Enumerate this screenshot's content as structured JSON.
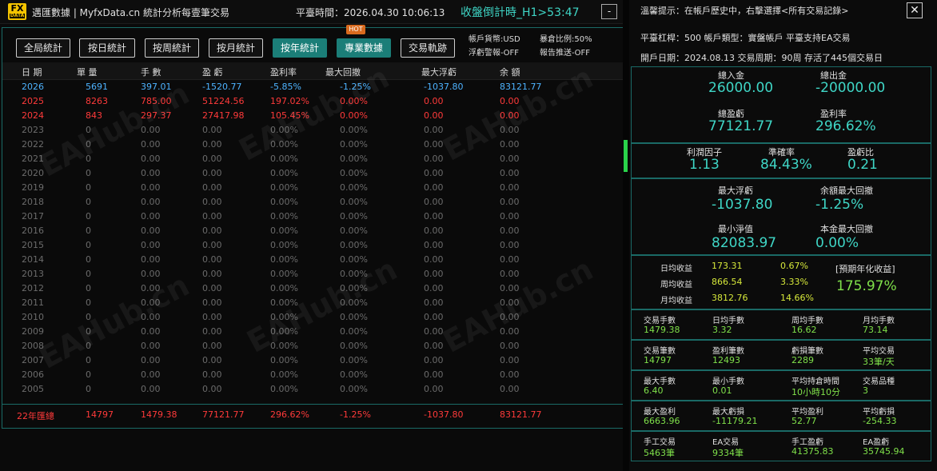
{
  "titlebar": {
    "logo_top": "FX",
    "logo_bottom": "DATA",
    "title": "邁匯數據 | MyfxData.cn  統計分析每壹筆交易",
    "server_time": "平臺時間：2026.04.30 10:06:13",
    "countdown": "收盤倒計時_H1>53:47",
    "minimize": "-"
  },
  "tabs": [
    "全局統計",
    "按日統計",
    "按周統計",
    "按月統計",
    "按年統計",
    "專業數據",
    "交易軌跡"
  ],
  "hot_badge": "HOT",
  "account_info": {
    "currency": "帳戶貨幣:USD",
    "float_alert": "浮虧警報-OFF",
    "margin_ratio": "暴倉比例:50%",
    "report_push": "報告推送-OFF"
  },
  "table": {
    "headers": [
      "日 期",
      "單 量",
      "手 數",
      "盈 虧",
      "盈利率",
      "最大回撤",
      "最大浮虧",
      "余 額"
    ],
    "rows": [
      [
        "2026",
        "5691",
        "397.01",
        "-1520.77",
        "-5.85%",
        "-1.25%",
        "-1037.80",
        "83121.77"
      ],
      [
        "2025",
        "8263",
        "785.00",
        "51224.56",
        "197.02%",
        "0.00%",
        "0.00",
        "0.00"
      ],
      [
        "2024",
        "843",
        "297.37",
        "27417.98",
        "105.45%",
        "0.00%",
        "0.00",
        "0.00"
      ],
      [
        "2023",
        "0",
        "0.00",
        "0.00",
        "0.00%",
        "0.00%",
        "0.00",
        "0.00"
      ],
      [
        "2022",
        "0",
        "0.00",
        "0.00",
        "0.00%",
        "0.00%",
        "0.00",
        "0.00"
      ],
      [
        "2021",
        "0",
        "0.00",
        "0.00",
        "0.00%",
        "0.00%",
        "0.00",
        "0.00"
      ],
      [
        "2020",
        "0",
        "0.00",
        "0.00",
        "0.00%",
        "0.00%",
        "0.00",
        "0.00"
      ],
      [
        "2019",
        "0",
        "0.00",
        "0.00",
        "0.00%",
        "0.00%",
        "0.00",
        "0.00"
      ],
      [
        "2018",
        "0",
        "0.00",
        "0.00",
        "0.00%",
        "0.00%",
        "0.00",
        "0.00"
      ],
      [
        "2017",
        "0",
        "0.00",
        "0.00",
        "0.00%",
        "0.00%",
        "0.00",
        "0.00"
      ],
      [
        "2016",
        "0",
        "0.00",
        "0.00",
        "0.00%",
        "0.00%",
        "0.00",
        "0.00"
      ],
      [
        "2015",
        "0",
        "0.00",
        "0.00",
        "0.00%",
        "0.00%",
        "0.00",
        "0.00"
      ],
      [
        "2014",
        "0",
        "0.00",
        "0.00",
        "0.00%",
        "0.00%",
        "0.00",
        "0.00"
      ],
      [
        "2013",
        "0",
        "0.00",
        "0.00",
        "0.00%",
        "0.00%",
        "0.00",
        "0.00"
      ],
      [
        "2012",
        "0",
        "0.00",
        "0.00",
        "0.00%",
        "0.00%",
        "0.00",
        "0.00"
      ],
      [
        "2011",
        "0",
        "0.00",
        "0.00",
        "0.00%",
        "0.00%",
        "0.00",
        "0.00"
      ],
      [
        "2010",
        "0",
        "0.00",
        "0.00",
        "0.00%",
        "0.00%",
        "0.00",
        "0.00"
      ],
      [
        "2009",
        "0",
        "0.00",
        "0.00",
        "0.00%",
        "0.00%",
        "0.00",
        "0.00"
      ],
      [
        "2008",
        "0",
        "0.00",
        "0.00",
        "0.00%",
        "0.00%",
        "0.00",
        "0.00"
      ],
      [
        "2007",
        "0",
        "0.00",
        "0.00",
        "0.00%",
        "0.00%",
        "0.00",
        "0.00"
      ],
      [
        "2006",
        "0",
        "0.00",
        "0.00",
        "0.00%",
        "0.00%",
        "0.00",
        "0.00"
      ],
      [
        "2005",
        "0",
        "0.00",
        "0.00",
        "0.00%",
        "0.00%",
        "0.00",
        "0.00"
      ]
    ],
    "summary": [
      "22年匯總",
      "14797",
      "1479.38",
      "77121.77",
      "296.62%",
      "-1.25%",
      "-1037.80",
      "83121.77"
    ]
  },
  "watermark": "EAHub.cn",
  "right": {
    "tip": "溫馨提示：在帳戶歷史中，右擊選擇<所有交易記錄>",
    "close": "✕",
    "line1": "平臺杠桿：500      帳戶類型：實盤帳戶      平臺支持EA交易",
    "line2": "開戶日期：2024.08.13    交易周期：90周    存活了445個交易日",
    "deposit_label": "總入金",
    "deposit": "26000.00",
    "withdraw_label": "總出金",
    "withdraw": "-20000.00",
    "profit_label": "總盈虧",
    "profit": "77121.77",
    "rate_label": "盈利率",
    "rate": "296.62%",
    "pf_label": "利潤因子",
    "pf": "1.13",
    "acc_label": "準確率",
    "acc": "84.43%",
    "pl_label": "盈虧比",
    "pl": "0.21",
    "maxfloat_label": "最大浮虧",
    "maxfloat": "-1037.80",
    "maxdd_label": "余額最大回撤",
    "maxdd": "-1.25%",
    "minnet_label": "最小淨值",
    "minnet": "82083.97",
    "principal_label": "本金最大回撤",
    "principal": "0.00%",
    "daily_label": "日均收益",
    "daily": "173.31",
    "daily_pct": "0.67%",
    "weekly_label": "周均收益",
    "weekly": "866.54",
    "weekly_pct": "3.33%",
    "monthly_label": "月均收益",
    "monthly": "3812.76",
    "monthly_pct": "14.66%",
    "annual_label": "[預期年化收益]",
    "annual": "175.97%",
    "stats": [
      {
        "label": "交易手數",
        "value": "1479.38"
      },
      {
        "label": "日均手數",
        "value": "3.32"
      },
      {
        "label": "周均手數",
        "value": "16.62"
      },
      {
        "label": "月均手數",
        "value": "73.14"
      },
      {
        "label": "交易筆數",
        "value": "14797"
      },
      {
        "label": "盈利筆數",
        "value": "12493"
      },
      {
        "label": "虧損筆數",
        "value": "2289"
      },
      {
        "label": "平均交易",
        "value": "33筆/天"
      },
      {
        "label": "最大手數",
        "value": "6.40"
      },
      {
        "label": "最小手數",
        "value": "0.01"
      },
      {
        "label": "平均持倉時間",
        "value": "10小時10分"
      },
      {
        "label": "交易品種",
        "value": "3"
      },
      {
        "label": "最大盈利",
        "value": "6663.96"
      },
      {
        "label": "最大虧損",
        "value": "-11179.21"
      },
      {
        "label": "平均盈利",
        "value": "52.77"
      },
      {
        "label": "平均虧損",
        "value": "-254.33"
      },
      {
        "label": "手工交易",
        "value": "5463筆"
      },
      {
        "label": "EA交易",
        "value": "9334筆"
      },
      {
        "label": "手工盈虧",
        "value": "41375.83"
      },
      {
        "label": "EA盈虧",
        "value": "35745.94"
      }
    ]
  },
  "colors": {
    "accent": "#1b7e78",
    "teal_text": "#3fd6c6",
    "red": "#ff3a3a",
    "blue": "#4db3ff",
    "yellow_green": "#d6e83a"
  }
}
